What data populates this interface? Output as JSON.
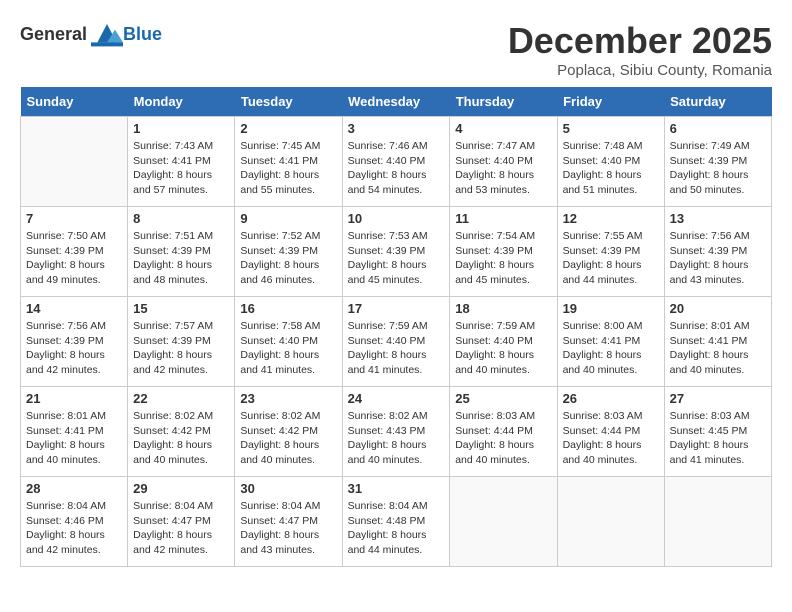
{
  "header": {
    "logo_general": "General",
    "logo_blue": "Blue",
    "month_year": "December 2025",
    "location": "Poplaca, Sibiu County, Romania"
  },
  "weekdays": [
    "Sunday",
    "Monday",
    "Tuesday",
    "Wednesday",
    "Thursday",
    "Friday",
    "Saturday"
  ],
  "weeks": [
    [
      {
        "day": "",
        "detail": ""
      },
      {
        "day": "1",
        "detail": "Sunrise: 7:43 AM\nSunset: 4:41 PM\nDaylight: 8 hours\nand 57 minutes."
      },
      {
        "day": "2",
        "detail": "Sunrise: 7:45 AM\nSunset: 4:41 PM\nDaylight: 8 hours\nand 55 minutes."
      },
      {
        "day": "3",
        "detail": "Sunrise: 7:46 AM\nSunset: 4:40 PM\nDaylight: 8 hours\nand 54 minutes."
      },
      {
        "day": "4",
        "detail": "Sunrise: 7:47 AM\nSunset: 4:40 PM\nDaylight: 8 hours\nand 53 minutes."
      },
      {
        "day": "5",
        "detail": "Sunrise: 7:48 AM\nSunset: 4:40 PM\nDaylight: 8 hours\nand 51 minutes."
      },
      {
        "day": "6",
        "detail": "Sunrise: 7:49 AM\nSunset: 4:39 PM\nDaylight: 8 hours\nand 50 minutes."
      }
    ],
    [
      {
        "day": "7",
        "detail": "Sunrise: 7:50 AM\nSunset: 4:39 PM\nDaylight: 8 hours\nand 49 minutes."
      },
      {
        "day": "8",
        "detail": "Sunrise: 7:51 AM\nSunset: 4:39 PM\nDaylight: 8 hours\nand 48 minutes."
      },
      {
        "day": "9",
        "detail": "Sunrise: 7:52 AM\nSunset: 4:39 PM\nDaylight: 8 hours\nand 46 minutes."
      },
      {
        "day": "10",
        "detail": "Sunrise: 7:53 AM\nSunset: 4:39 PM\nDaylight: 8 hours\nand 45 minutes."
      },
      {
        "day": "11",
        "detail": "Sunrise: 7:54 AM\nSunset: 4:39 PM\nDaylight: 8 hours\nand 45 minutes."
      },
      {
        "day": "12",
        "detail": "Sunrise: 7:55 AM\nSunset: 4:39 PM\nDaylight: 8 hours\nand 44 minutes."
      },
      {
        "day": "13",
        "detail": "Sunrise: 7:56 AM\nSunset: 4:39 PM\nDaylight: 8 hours\nand 43 minutes."
      }
    ],
    [
      {
        "day": "14",
        "detail": "Sunrise: 7:56 AM\nSunset: 4:39 PM\nDaylight: 8 hours\nand 42 minutes."
      },
      {
        "day": "15",
        "detail": "Sunrise: 7:57 AM\nSunset: 4:39 PM\nDaylight: 8 hours\nand 42 minutes."
      },
      {
        "day": "16",
        "detail": "Sunrise: 7:58 AM\nSunset: 4:40 PM\nDaylight: 8 hours\nand 41 minutes."
      },
      {
        "day": "17",
        "detail": "Sunrise: 7:59 AM\nSunset: 4:40 PM\nDaylight: 8 hours\nand 41 minutes."
      },
      {
        "day": "18",
        "detail": "Sunrise: 7:59 AM\nSunset: 4:40 PM\nDaylight: 8 hours\nand 40 minutes."
      },
      {
        "day": "19",
        "detail": "Sunrise: 8:00 AM\nSunset: 4:41 PM\nDaylight: 8 hours\nand 40 minutes."
      },
      {
        "day": "20",
        "detail": "Sunrise: 8:01 AM\nSunset: 4:41 PM\nDaylight: 8 hours\nand 40 minutes."
      }
    ],
    [
      {
        "day": "21",
        "detail": "Sunrise: 8:01 AM\nSunset: 4:41 PM\nDaylight: 8 hours\nand 40 minutes."
      },
      {
        "day": "22",
        "detail": "Sunrise: 8:02 AM\nSunset: 4:42 PM\nDaylight: 8 hours\nand 40 minutes."
      },
      {
        "day": "23",
        "detail": "Sunrise: 8:02 AM\nSunset: 4:42 PM\nDaylight: 8 hours\nand 40 minutes."
      },
      {
        "day": "24",
        "detail": "Sunrise: 8:02 AM\nSunset: 4:43 PM\nDaylight: 8 hours\nand 40 minutes."
      },
      {
        "day": "25",
        "detail": "Sunrise: 8:03 AM\nSunset: 4:44 PM\nDaylight: 8 hours\nand 40 minutes."
      },
      {
        "day": "26",
        "detail": "Sunrise: 8:03 AM\nSunset: 4:44 PM\nDaylight: 8 hours\nand 40 minutes."
      },
      {
        "day": "27",
        "detail": "Sunrise: 8:03 AM\nSunset: 4:45 PM\nDaylight: 8 hours\nand 41 minutes."
      }
    ],
    [
      {
        "day": "28",
        "detail": "Sunrise: 8:04 AM\nSunset: 4:46 PM\nDaylight: 8 hours\nand 42 minutes."
      },
      {
        "day": "29",
        "detail": "Sunrise: 8:04 AM\nSunset: 4:47 PM\nDaylight: 8 hours\nand 42 minutes."
      },
      {
        "day": "30",
        "detail": "Sunrise: 8:04 AM\nSunset: 4:47 PM\nDaylight: 8 hours\nand 43 minutes."
      },
      {
        "day": "31",
        "detail": "Sunrise: 8:04 AM\nSunset: 4:48 PM\nDaylight: 8 hours\nand 44 minutes."
      },
      {
        "day": "",
        "detail": ""
      },
      {
        "day": "",
        "detail": ""
      },
      {
        "day": "",
        "detail": ""
      }
    ]
  ]
}
